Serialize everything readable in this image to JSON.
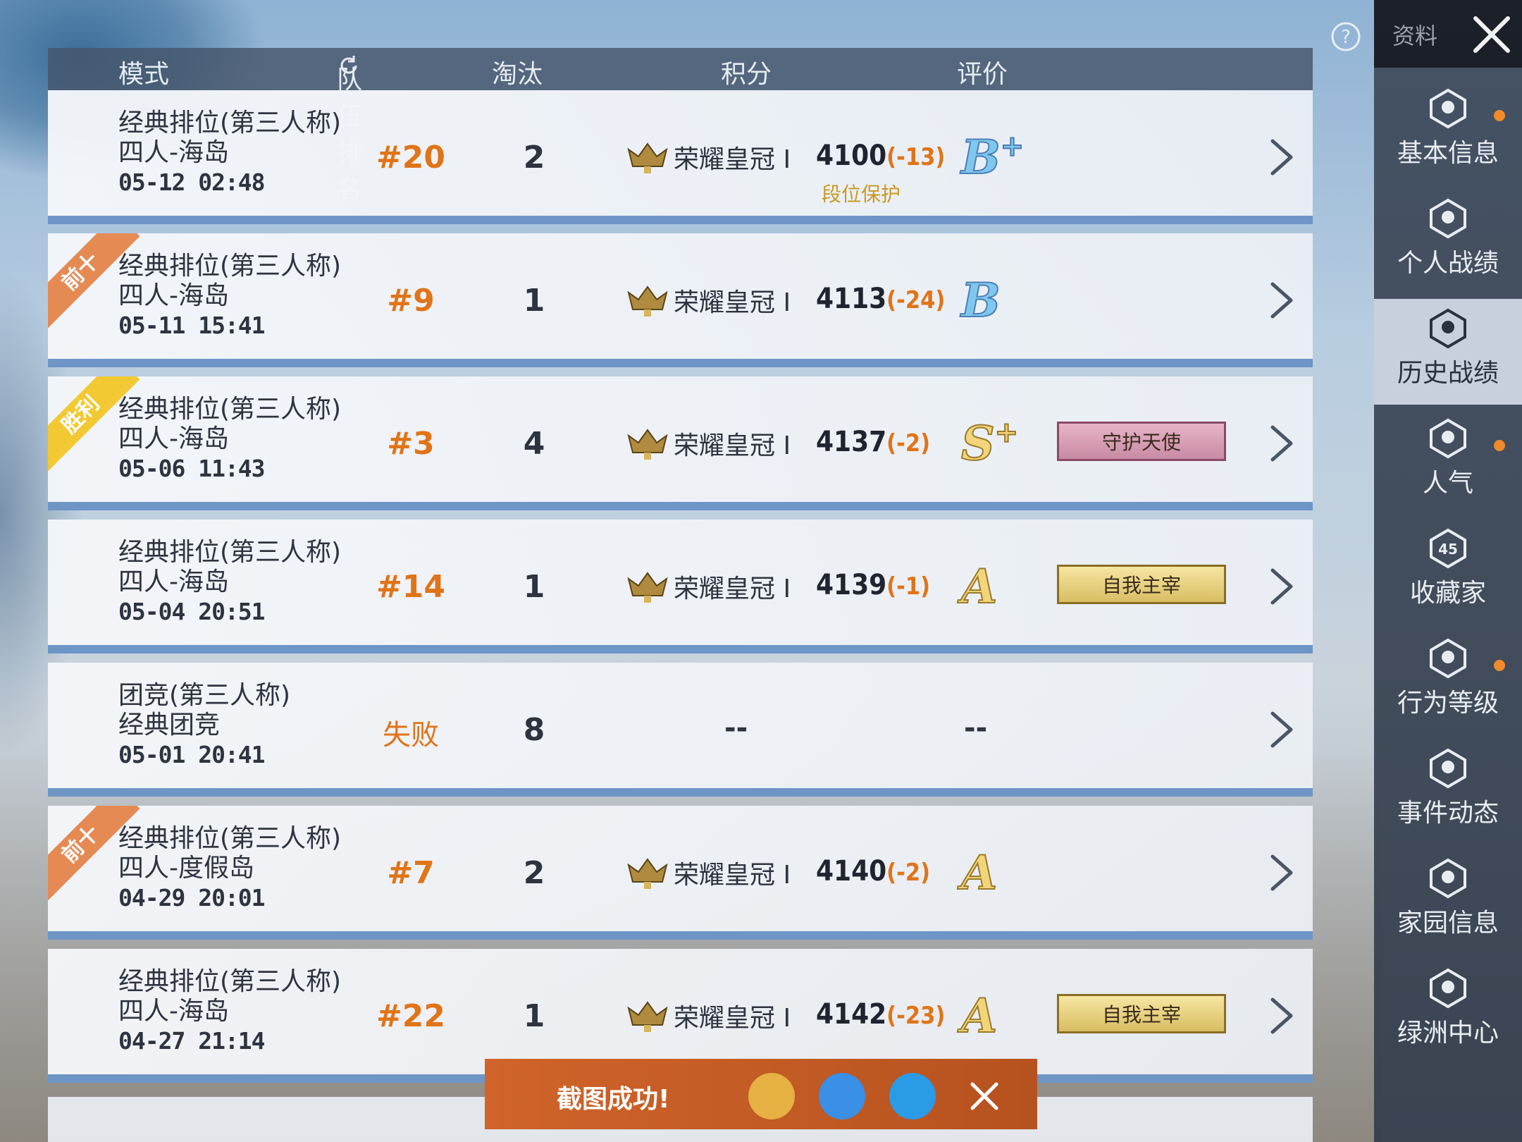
{
  "header": {
    "mode": "模式",
    "team_rank": "队伍排名",
    "eliminations": "淘汰",
    "score": "积分",
    "rating": "评价"
  },
  "rows": [
    {
      "ribbon": "",
      "mode": "经典排位(第三人称)",
      "map": "四人-海岛",
      "date": "05-12 02:48",
      "rank": "#20",
      "elim": "2",
      "tier": "荣耀皇冠 I",
      "score": "4100",
      "delta": "(-13)",
      "note": "段位保护",
      "grade": "B",
      "grade_plus": "+",
      "badge": ""
    },
    {
      "ribbon": "前十",
      "mode": "经典排位(第三人称)",
      "map": "四人-海岛",
      "date": "05-11 15:41",
      "rank": "#9",
      "elim": "1",
      "tier": "荣耀皇冠 I",
      "score": "4113",
      "delta": "(-24)",
      "note": "",
      "grade": "B",
      "grade_plus": "",
      "badge": ""
    },
    {
      "ribbon": "胜利",
      "mode": "经典排位(第三人称)",
      "map": "四人-海岛",
      "date": "05-06 11:43",
      "rank": "#3",
      "elim": "4",
      "tier": "荣耀皇冠 I",
      "score": "4137",
      "delta": "(-2)",
      "note": "",
      "grade": "S",
      "grade_plus": "+",
      "badge": "守护天使"
    },
    {
      "ribbon": "",
      "mode": "经典排位(第三人称)",
      "map": "四人-海岛",
      "date": "05-04 20:51",
      "rank": "#14",
      "elim": "1",
      "tier": "荣耀皇冠 I",
      "score": "4139",
      "delta": "(-1)",
      "note": "",
      "grade": "A",
      "grade_plus": "",
      "badge": "自我主宰"
    },
    {
      "ribbon": "",
      "mode": "团竞(第三人称)",
      "map": "经典团竞",
      "date": "05-01 20:41",
      "rank": "失败",
      "elim": "8",
      "tier": "",
      "score": "--",
      "delta": "",
      "note": "",
      "grade": "--",
      "grade_plus": "",
      "badge": ""
    },
    {
      "ribbon": "前十",
      "mode": "经典排位(第三人称)",
      "map": "四人-度假岛",
      "date": "04-29 20:01",
      "rank": "#7",
      "elim": "2",
      "tier": "荣耀皇冠 I",
      "score": "4140",
      "delta": "(-2)",
      "note": "",
      "grade": "A",
      "grade_plus": "",
      "badge": ""
    },
    {
      "ribbon": "",
      "mode": "经典排位(第三人称)",
      "map": "四人-海岛",
      "date": "04-27 21:14",
      "rank": "#22",
      "elim": "1",
      "tier": "荣耀皇冠 I",
      "score": "4142",
      "delta": "(-23)",
      "note": "",
      "grade": "A",
      "grade_plus": "",
      "badge": "自我主宰"
    }
  ],
  "sidebar": {
    "title": "资料",
    "items": [
      {
        "label": "基本信息",
        "dot": true
      },
      {
        "label": "个人战绩",
        "dot": false
      },
      {
        "label": "历史战绩",
        "dot": false,
        "active": true
      },
      {
        "label": "人气",
        "dot": true
      },
      {
        "label": "收藏家",
        "dot": false,
        "level": "45"
      },
      {
        "label": "行为等级",
        "dot": true
      },
      {
        "label": "事件动态",
        "dot": false
      },
      {
        "label": "家园信息",
        "dot": false
      },
      {
        "label": "绿洲中心",
        "dot": false
      }
    ]
  },
  "toast": {
    "text": "截图成功!"
  },
  "colors": {
    "accent": "#e07418",
    "row_border": "#6d95c6",
    "sidebar_active": "#d2dce8"
  }
}
